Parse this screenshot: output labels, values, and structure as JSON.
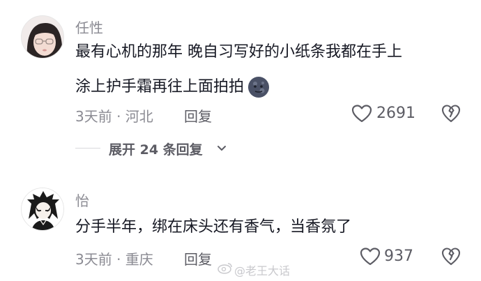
{
  "comments": [
    {
      "author": "任性",
      "text_line1": "最有心机的那年 晚自习写好的小纸条我都在手上",
      "text_line2": "涂上护手霜再往上面拍拍",
      "emoji": "new-moon-face-emoji",
      "time_location": "3天前 · 河北",
      "reply_label": "回复",
      "likes": "2691",
      "expand_label": "展开 24 条回复"
    },
    {
      "author": "怡",
      "text": "分手半年，绑在床头还有香气，当香氛了",
      "time_location": "3天前 · 重庆",
      "reply_label": "回复",
      "likes": "937"
    }
  ],
  "watermark": "@老王大话",
  "icons": {
    "like": "heart-outline-icon",
    "dislike": "broken-heart-icon",
    "expand": "chevron-down-icon",
    "watermark": "weibo-logo-icon"
  }
}
